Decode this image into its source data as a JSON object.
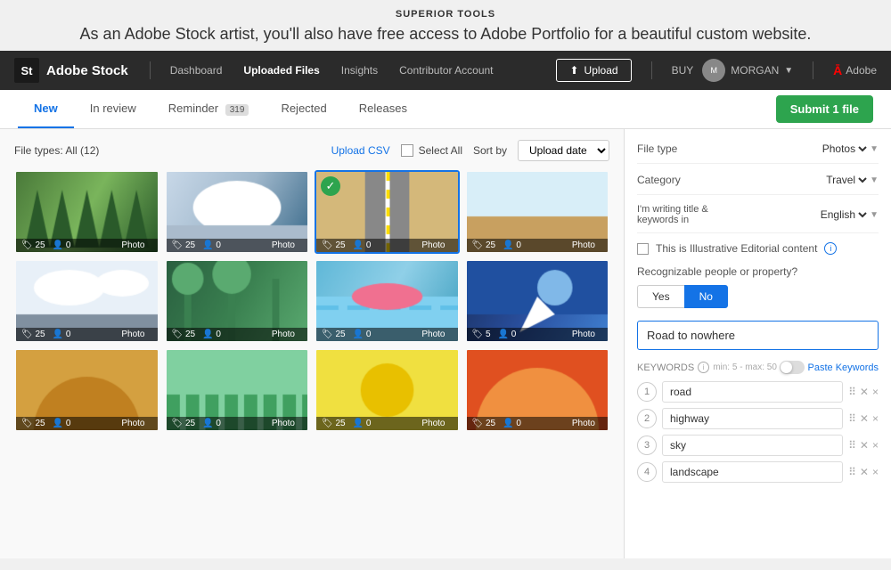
{
  "app": {
    "title": "SUPERIOR TOOLS",
    "promo": "As an Adobe Stock artist, you'll also have free access to Adobe Portfolio for a beautiful custom website."
  },
  "navbar": {
    "brand_icon": "St",
    "brand_name": "Adobe Stock",
    "links": [
      {
        "label": "Dashboard",
        "active": false
      },
      {
        "label": "Uploaded Files",
        "active": true
      },
      {
        "label": "Insights",
        "active": false
      },
      {
        "label": "Contributor Account",
        "active": false
      }
    ],
    "upload_btn": "Upload",
    "buy_label": "BUY",
    "user_name": "MORGAN",
    "adobe_label": "Adobe"
  },
  "tabs": {
    "items": [
      {
        "label": "New",
        "active": true,
        "badge": null
      },
      {
        "label": "In review",
        "active": false,
        "badge": null
      },
      {
        "label": "Reminder",
        "active": false,
        "badge": "319"
      },
      {
        "label": "Rejected",
        "active": false,
        "badge": null
      },
      {
        "label": "Releases",
        "active": false,
        "badge": null
      }
    ],
    "submit_btn": "Submit 1 file"
  },
  "toolbar": {
    "file_type": "File types: All (12)",
    "upload_csv": "Upload CSV",
    "select_all": "Select All",
    "sort_label": "Sort by",
    "sort_value": "Upload date"
  },
  "images": [
    {
      "color1": "#4a7a3a",
      "color2": "#7ab55c",
      "color3": "#2a5a2a",
      "tags": 25,
      "people": 0,
      "type": "Photo",
      "selected": false
    },
    {
      "color1": "#c8d8e8",
      "color2": "#a0b8cc",
      "color3": "#607080",
      "tags": 25,
      "people": 0,
      "type": "Photo",
      "selected": false
    },
    {
      "color1": "#8b7355",
      "color2": "#c4a882",
      "color3": "#d4b87a",
      "tags": 25,
      "people": 0,
      "type": "Photo",
      "selected": true
    },
    {
      "color1": "#5090b0",
      "color2": "#7ab0d0",
      "color3": "#a0c8e0",
      "tags": 25,
      "people": 0,
      "type": "Photo",
      "selected": false
    },
    {
      "color1": "#b0c8d8",
      "color2": "#d0e0e8",
      "color3": "#90aab8",
      "tags": 25,
      "people": 0,
      "type": "Photo",
      "selected": false
    },
    {
      "color1": "#2a6040",
      "color2": "#3a8050",
      "color3": "#5aaa70",
      "tags": 25,
      "people": 0,
      "type": "Photo",
      "selected": false
    },
    {
      "color1": "#60b8d8",
      "color2": "#90d0e8",
      "color3": "#c0e8f8",
      "tags": 25,
      "people": 0,
      "type": "Photo",
      "selected": false
    },
    {
      "color1": "#1a3060",
      "color2": "#2a50a0",
      "color3": "#4080d0",
      "tags": 5,
      "people": 0,
      "type": "Photo",
      "selected": false
    },
    {
      "color1": "#d4a040",
      "color2": "#e8c060",
      "color3": "#f0d880",
      "tags": 25,
      "people": 0,
      "type": "Photo",
      "selected": false
    },
    {
      "color1": "#60a870",
      "color2": "#80c890",
      "color3": "#50886090",
      "tags": 25,
      "people": 0,
      "type": "Photo",
      "selected": false
    },
    {
      "color1": "#e8d040",
      "color2": "#f0e060",
      "color3": "#d0b820",
      "tags": 25,
      "people": 0,
      "type": "Photo",
      "selected": false
    },
    {
      "color1": "#e05020",
      "color2": "#f07040",
      "color3": "#c03010",
      "tags": 25,
      "people": 0,
      "type": "Photo",
      "selected": false
    }
  ],
  "right_panel": {
    "file_type_label": "File type",
    "file_type_value": "Photos",
    "category_label": "Category",
    "category_value": "Travel",
    "language_label": "I'm writing title & keywords in",
    "language_value": "English",
    "illustrative_label": "This is Illustrative Editorial content",
    "recognizable_label": "Recognizable people or property?",
    "yes_label": "Yes",
    "no_label": "No",
    "title_value": "Road to nowhere",
    "keywords_label": "KEYWORDS",
    "keywords_hint": "min: 5 - max: 50",
    "paste_keywords": "Paste Keywords",
    "keywords": [
      {
        "num": 1,
        "value": "road"
      },
      {
        "num": 2,
        "value": "highway"
      },
      {
        "num": 3,
        "value": "sky"
      },
      {
        "num": 4,
        "value": "landscape"
      }
    ]
  }
}
